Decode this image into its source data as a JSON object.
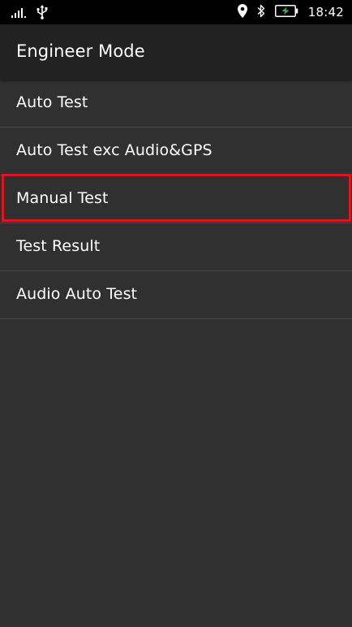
{
  "status_bar": {
    "time": "18:42",
    "icons": [
      "signal-icon",
      "usb-icon",
      "location-icon",
      "bluetooth-icon",
      "battery-charging-icon"
    ]
  },
  "app_bar": {
    "title": "Engineer Mode"
  },
  "menu": {
    "items": [
      {
        "label": "Auto Test"
      },
      {
        "label": "Auto Test exc Audio&GPS"
      },
      {
        "label": "Manual Test"
      },
      {
        "label": "Test Result"
      },
      {
        "label": "Audio Auto Test"
      }
    ]
  },
  "highlight": {
    "target": "Manual Test",
    "color": "#e0141c"
  },
  "colors": {
    "background": "#303030",
    "app_bar": "#222222",
    "status_bar": "#000000",
    "divider": "#484848",
    "battery_bolt": "#4caf50"
  }
}
